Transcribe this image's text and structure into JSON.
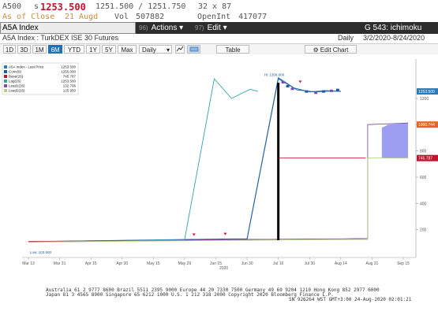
{
  "quote": {
    "ticker": "A500",
    "price_prefix": "s",
    "last_price": "1253.500",
    "bid_ask": "1251.500 / 1251.750",
    "size": "32 x 87",
    "as_of_label": "As of Close",
    "as_of_date": "21 Augd",
    "vol_label": "Vol",
    "vol_value": "507882",
    "openint_label": "OpenInt",
    "openint_value": "417077"
  },
  "command": {
    "security": "A5A Index",
    "actions_num": "96)",
    "actions_label": "Actions",
    "edit_num": "97)",
    "edit_label": "Edit",
    "screen_label": "G 543: ichimoku"
  },
  "title_bar": {
    "security_desc": "A5A Index : TurkDEX ISE 30 Futures",
    "period": "Daily",
    "date_range": "3/2/2020-8/24/2020"
  },
  "toolbar": {
    "ranges": [
      "1D",
      "3D",
      "1M",
      "6M",
      "YTD",
      "1Y",
      "5Y",
      "Max"
    ],
    "active_range": "6M",
    "frequency": "Daily",
    "table_label": "Table",
    "edit_chart_label": "Edit Chart"
  },
  "legend": [
    {
      "label": "A5A Index - Last Price",
      "value": "1253.500",
      "color": "#2a7ab8"
    },
    {
      "label": "Conv(9)",
      "value": "1255.000",
      "color": "#1f5aa6"
    },
    {
      "label": "Base(26)",
      "value": "745.787",
      "color": "#c8102e"
    },
    {
      "label": "Lag(26)",
      "value": "1253.500",
      "color": "#2aa7a7"
    },
    {
      "label": "Lead1(26)",
      "value": "132.706",
      "color": "#7a4fb0"
    },
    {
      "label": "Lead2(26)",
      "value": "125.950",
      "color": "#b5cf7e"
    }
  ],
  "annotations": {
    "high_label": "Hi: 1358.000",
    "low_label": "Low: 103.500"
  },
  "right_tags": [
    {
      "text": "1253.500",
      "color": "#2a7ab8",
      "value": 1253.5
    },
    {
      "text": "1000.744",
      "color": "#e8641e",
      "value": 1000.744
    },
    {
      "text": "745.787",
      "color": "#c8102e",
      "value": 745.787
    }
  ],
  "chart_data": {
    "type": "line",
    "x_tick_labels": [
      "Mar 13",
      "Mar 31",
      "Apr 15",
      "Apr 30",
      "May 15",
      "May 29",
      "Jun 15",
      "Jun 30",
      "Jul 16",
      "Jul 30",
      "Aug 14",
      "Aug 31",
      "Sep 15"
    ],
    "x_sub_label": "2020",
    "y_tick_labels": [
      "200",
      "400",
      "600",
      "800",
      "1000",
      "1200"
    ],
    "ylim": [
      0,
      1500
    ],
    "grid": false,
    "legend_position": "top-left",
    "series": [
      {
        "name": "A5A Index - Last Price",
        "color": "#2a7ab8",
        "values": [
          107,
          110,
          115,
          118,
          122,
          125,
          128,
          130,
          1358,
          1280,
          1250,
          1260,
          1253.5
        ]
      },
      {
        "name": "Conv(9)",
        "color": "#1f5aa6",
        "values": [
          110,
          112,
          115,
          118,
          120,
          124,
          126,
          130,
          1350,
          1265,
          1250,
          1255,
          1255
        ]
      },
      {
        "name": "Base(26)",
        "color": "#c8102e",
        "values": [
          111,
          112,
          114,
          116,
          118,
          120,
          123,
          126,
          745.787,
          745.787,
          745.787,
          745.787,
          745.787
        ]
      },
      {
        "name": "Lag(26)",
        "color": "#2aa7a7",
        "values": [
          106,
          108,
          112,
          115,
          120,
          125,
          1350,
          1200,
          1270,
          1253.5
        ]
      },
      {
        "name": "Lead1(26)",
        "color": "#7a4fb0",
        "values": [
          108,
          109,
          111,
          114,
          117,
          120,
          122,
          125,
          127,
          129,
          130,
          132,
          132.706,
          1000.744
        ]
      },
      {
        "name": "Lead2(26)",
        "color": "#b5cf7e",
        "values": [
          107,
          108,
          110,
          112,
          114,
          116,
          118,
          120,
          122,
          124,
          125,
          126,
          125.95,
          745.787
        ]
      }
    ]
  },
  "footer": {
    "line1": "Australia 61 2 9777 8600 Brazil 5511 2395 9000 Europe 44 20 7330 7500 Germany 49 69 9204 1210 Hong Kong 852 2977 6000",
    "line2": "Japan 81 3 4565 8900         Singapore 65 6212 1000     U.S. 1 212 318 2000          Copyright 2020 Bloomberg Finance L.P.",
    "line3": "SN 926264 WST  GMT+3:00 24-Aug-2020 02:01:21"
  },
  "colors": {
    "price_red": "#c8102e",
    "accent_orange": "#d08a3a",
    "cmd_bar_bg": "#2d2d2d",
    "active_tab": "#1f6fbf",
    "cloud_fill": "#8c8cf0"
  }
}
